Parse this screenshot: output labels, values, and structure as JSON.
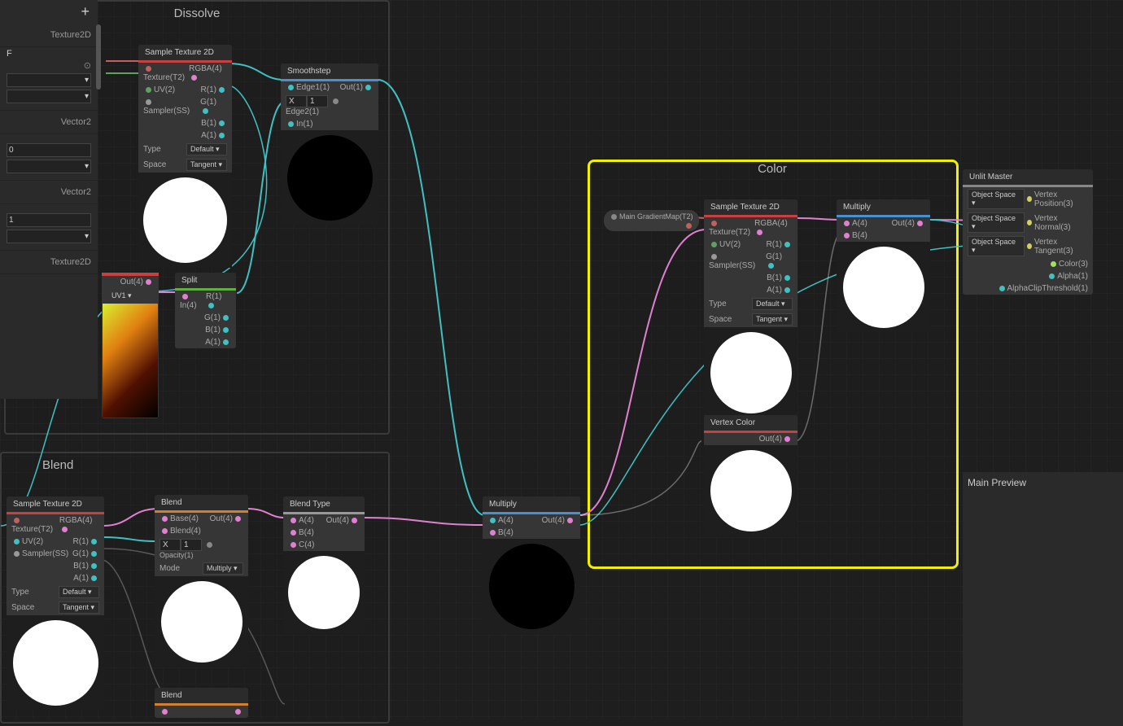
{
  "groups": {
    "dissolve": "Dissolve",
    "blend": "Blend",
    "color": "Color"
  },
  "sidebar": {
    "texture2d_1": "Texture2D",
    "letter": "F",
    "vector2_1": "Vector2",
    "field_zero": "0",
    "vector2_2": "Vector2",
    "field_one": "1",
    "texture2d_2": "Texture2D"
  },
  "nodes": {
    "sample1": {
      "title": "Sample Texture 2D",
      "in": [
        "Texture(T2)",
        "UV(2)",
        "Sampler(SS)"
      ],
      "out": [
        "RGBA(4)",
        "R(1)",
        "G(1)",
        "B(1)",
        "A(1)"
      ],
      "type_label": "Type",
      "type_val": "Default",
      "space_label": "Space",
      "space_val": "Tangent"
    },
    "smoothstep": {
      "title": "Smoothstep",
      "in": [
        "Edge1(1)",
        "Edge2(1)",
        "In(1)"
      ],
      "out": "Out(1)",
      "x": "X",
      "one": "1"
    },
    "out4": {
      "out": "Out(4)",
      "uv": "UV1"
    },
    "split": {
      "title": "Split",
      "in": "In(4)",
      "out": [
        "R(1)",
        "G(1)",
        "B(1)",
        "A(1)"
      ]
    },
    "sample2": {
      "title": "Sample Texture 2D",
      "in": [
        "Texture(T2)",
        "UV(2)",
        "Sampler(SS)"
      ],
      "out": [
        "RGBA(4)",
        "R(1)",
        "G(1)",
        "B(1)",
        "A(1)"
      ],
      "type_label": "Type",
      "type_val": "Default",
      "space_label": "Space",
      "space_val": "Tangent"
    },
    "blendA": {
      "title": "Blend",
      "in": [
        "Base(4)",
        "Blend(4)",
        "Opacity(1)"
      ],
      "out": "Out(4)",
      "mode_label": "Mode",
      "mode_val": "Multiply",
      "x": "X",
      "one": "1"
    },
    "blendtype": {
      "title": "Blend Type",
      "in": [
        "A(4)",
        "B(4)",
        "C(4)"
      ],
      "out": "Out(4)"
    },
    "multiply1": {
      "title": "Multiply",
      "in": [
        "A(4)",
        "B(4)"
      ],
      "out": "Out(4)"
    },
    "maingrad": {
      "label": "Main GradientMap(T2)"
    },
    "sample3": {
      "title": "Sample Texture 2D",
      "in": [
        "Texture(T2)",
        "UV(2)",
        "Sampler(SS)"
      ],
      "out": [
        "RGBA(4)",
        "R(1)",
        "G(1)",
        "B(1)",
        "A(1)"
      ],
      "type_label": "Type",
      "type_val": "Default",
      "space_label": "Space",
      "space_val": "Tangent"
    },
    "vcolor": {
      "title": "Vertex Color",
      "out": "Out(4)"
    },
    "multiply2": {
      "title": "Multiply",
      "in": [
        "A(4)",
        "B(4)"
      ],
      "out": "Out(4)"
    },
    "blendB": {
      "title": "Blend"
    },
    "unlit": {
      "title": "Unlit Master",
      "os": "Object Space",
      "rows": [
        "Vertex Position(3)",
        "Vertex Normal(3)",
        "Vertex Tangent(3)",
        "Color(3)",
        "Alpha(1)",
        "AlphaClipThreshold(1)"
      ]
    }
  },
  "mainPreview": "Main Preview",
  "colors": {
    "red": "#c84040",
    "orange": "#d08030",
    "green": "#60b040",
    "blue": "#4890d0",
    "grey": "#888",
    "teal": "#40c0c0",
    "pink": "#e080d0",
    "lime": "#a0e060",
    "yellow": "#d0d060"
  }
}
